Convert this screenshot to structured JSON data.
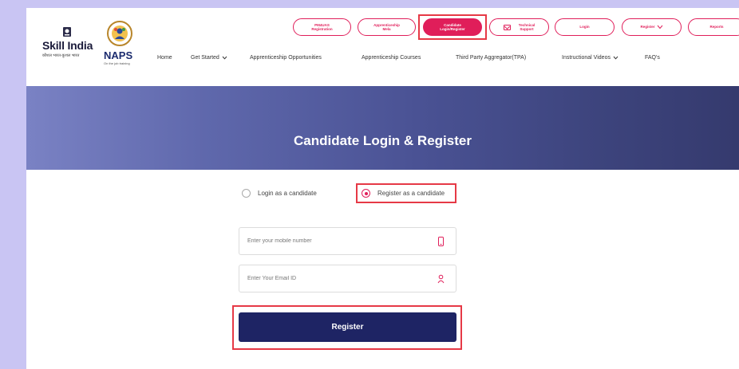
{
  "header": {
    "skill_logo": {
      "title": "Skill India",
      "subtitle": "कौशल भारत-कुशल भारत"
    },
    "naps_logo": {
      "title": "NAPS",
      "subtitle": "On the job training"
    },
    "top_buttons": [
      {
        "label": "PM4UAS\nRegistration"
      },
      {
        "label": "Apprenticeship\nMela"
      },
      {
        "label": "Candidate\nLogin/Register"
      },
      {
        "label": "Technical\nSupport"
      },
      {
        "label": "Login"
      },
      {
        "label": "Register"
      },
      {
        "label": "Reports"
      }
    ],
    "nav": [
      {
        "label": "Home"
      },
      {
        "label": "Get Started"
      },
      {
        "label": "Apprenticeship Opportunities"
      },
      {
        "label": "Apprenticeship Courses"
      },
      {
        "label": "Third Party Aggregator(TPA)"
      },
      {
        "label": "Instructional Videos"
      },
      {
        "label": "FAQ's"
      }
    ]
  },
  "banner": {
    "title": "Candidate Login & Register"
  },
  "auth_mode": {
    "options": [
      {
        "label": "Login as a candidate",
        "selected": false
      },
      {
        "label": "Register as a candidate",
        "selected": true
      }
    ]
  },
  "form": {
    "mobile": {
      "placeholder": "Enter your mobile number",
      "value": ""
    },
    "email": {
      "placeholder": "Enter Your Email ID",
      "value": ""
    },
    "submit_label": "Register"
  },
  "colors": {
    "accent": "#e01e5a",
    "button": "#1e2464",
    "highlight": "#e63946",
    "backdrop": "#c9c5f3"
  },
  "icons": [
    "skill-india-emblem-icon",
    "naps-emblem-icon",
    "envelope-icon",
    "chevron-down-icon",
    "mobile-phone-icon",
    "user-icon"
  ]
}
